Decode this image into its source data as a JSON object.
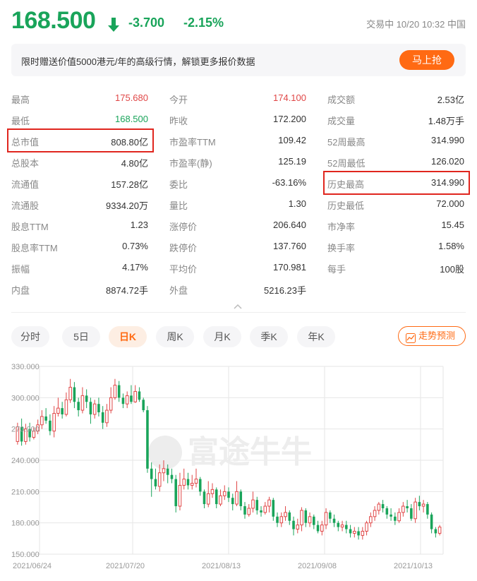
{
  "quote": {
    "price": "168.500",
    "change": "-3.700",
    "change_pct": "-2.15%",
    "status": "交易中 10/20 10:32 中国"
  },
  "banner": {
    "text": "限时赠送价值5000港元/年的高级行情，解锁更多报价数据",
    "button": "马上抢"
  },
  "stats": [
    [
      {
        "label": "最高",
        "value": "175.680",
        "color": "red"
      },
      {
        "label": "最低",
        "value": "168.500",
        "color": "green"
      },
      {
        "label": "总市值",
        "value": "808.80亿"
      },
      {
        "label": "总股本",
        "value": "4.80亿"
      },
      {
        "label": "流通值",
        "value": "157.28亿"
      },
      {
        "label": "流通股",
        "value": "9334.20万"
      },
      {
        "label": "股息TTM",
        "value": "1.23"
      },
      {
        "label": "股息率TTM",
        "value": "0.73%"
      },
      {
        "label": "振幅",
        "value": "4.17%"
      },
      {
        "label": "内盘",
        "value": "8874.72手"
      }
    ],
    [
      {
        "label": "今开",
        "value": "174.100",
        "color": "red"
      },
      {
        "label": "昨收",
        "value": "172.200"
      },
      {
        "label": "市盈率TTM",
        "value": "109.42"
      },
      {
        "label": "市盈率(静)",
        "value": "125.19"
      },
      {
        "label": "委比",
        "value": "-63.16%"
      },
      {
        "label": "量比",
        "value": "1.30"
      },
      {
        "label": "涨停价",
        "value": "206.640"
      },
      {
        "label": "跌停价",
        "value": "137.760"
      },
      {
        "label": "平均价",
        "value": "170.981"
      },
      {
        "label": "外盘",
        "value": "5216.23手"
      }
    ],
    [
      {
        "label": "成交额",
        "value": "2.53亿"
      },
      {
        "label": "成交量",
        "value": "1.48万手"
      },
      {
        "label": "52周最高",
        "value": "314.990"
      },
      {
        "label": "52周最低",
        "value": "126.020"
      },
      {
        "label": "历史最高",
        "value": "314.990"
      },
      {
        "label": "历史最低",
        "value": "72.000"
      },
      {
        "label": "市净率",
        "value": "15.45"
      },
      {
        "label": "换手率",
        "value": "1.58%"
      },
      {
        "label": "每手",
        "value": "100股"
      }
    ]
  ],
  "tabs": [
    "分时",
    "5日",
    "日K",
    "周K",
    "月K",
    "季K",
    "年K"
  ],
  "active_tab": "日K",
  "trend_button": "走势预测",
  "watermark": "富途牛牛",
  "colors": {
    "up": "#e04747",
    "down": "#19a45a",
    "accent": "#ff6a13",
    "highlight": "#e0261e"
  },
  "chart_data": {
    "type": "candlestick",
    "y_ticks": [
      "330.000",
      "300.000",
      "270.000",
      "240.000",
      "210.000",
      "180.000",
      "150.000"
    ],
    "x_labels": [
      "2021/06/24",
      "2021/07/20",
      "2021/08/13",
      "2021/09/08",
      "2021/10/13"
    ],
    "ylim": [
      150,
      330
    ],
    "candles": [
      [
        258,
        272,
        276,
        255
      ],
      [
        272,
        258,
        280,
        254
      ],
      [
        258,
        270,
        275,
        255
      ],
      [
        270,
        262,
        276,
        258
      ],
      [
        262,
        268,
        272,
        260
      ],
      [
        268,
        274,
        279,
        265
      ],
      [
        274,
        282,
        288,
        270
      ],
      [
        282,
        278,
        290,
        275
      ],
      [
        278,
        268,
        284,
        264
      ],
      [
        268,
        285,
        292,
        262
      ],
      [
        285,
        290,
        300,
        282
      ],
      [
        290,
        284,
        296,
        280
      ],
      [
        284,
        298,
        305,
        282
      ],
      [
        298,
        310,
        318,
        295
      ],
      [
        310,
        296,
        315,
        290
      ],
      [
        296,
        288,
        300,
        282
      ],
      [
        288,
        302,
        310,
        285
      ],
      [
        302,
        296,
        308,
        290
      ],
      [
        296,
        284,
        300,
        275
      ],
      [
        284,
        294,
        298,
        280
      ],
      [
        294,
        286,
        300,
        282
      ],
      [
        286,
        276,
        292,
        270
      ],
      [
        276,
        288,
        294,
        272
      ],
      [
        288,
        300,
        310,
        285
      ],
      [
        300,
        312,
        318,
        298
      ],
      [
        312,
        300,
        316,
        296
      ],
      [
        300,
        294,
        304,
        290
      ],
      [
        294,
        302,
        306,
        290
      ],
      [
        302,
        296,
        312,
        294
      ],
      [
        296,
        306,
        312,
        295
      ],
      [
        306,
        298,
        310,
        296
      ],
      [
        298,
        288,
        300,
        286
      ],
      [
        288,
        232,
        292,
        228
      ],
      [
        232,
        222,
        238,
        205
      ],
      [
        222,
        215,
        232,
        212
      ],
      [
        215,
        228,
        236,
        210
      ],
      [
        228,
        232,
        240,
        220
      ],
      [
        232,
        226,
        236,
        218
      ],
      [
        226,
        222,
        232,
        218
      ],
      [
        222,
        196,
        226,
        190
      ],
      [
        196,
        216,
        228,
        192
      ],
      [
        216,
        222,
        232,
        212
      ],
      [
        222,
        216,
        228,
        212
      ],
      [
        216,
        218,
        226,
        212
      ],
      [
        218,
        222,
        232,
        214
      ],
      [
        222,
        210,
        224,
        206
      ],
      [
        210,
        198,
        212,
        194
      ],
      [
        198,
        208,
        220,
        195
      ],
      [
        208,
        212,
        218,
        204
      ],
      [
        212,
        198,
        214,
        194
      ],
      [
        198,
        206,
        212,
        196
      ],
      [
        206,
        210,
        216,
        202
      ],
      [
        210,
        204,
        214,
        200
      ],
      [
        204,
        198,
        208,
        192
      ],
      [
        198,
        210,
        220,
        196
      ],
      [
        210,
        196,
        212,
        192
      ],
      [
        196,
        188,
        200,
        184
      ],
      [
        188,
        194,
        198,
        186
      ],
      [
        194,
        202,
        210,
        190
      ],
      [
        202,
        192,
        205,
        188
      ],
      [
        192,
        190,
        196,
        186
      ],
      [
        190,
        196,
        200,
        188
      ],
      [
        196,
        202,
        205,
        190
      ],
      [
        202,
        186,
        204,
        182
      ],
      [
        186,
        180,
        190,
        176
      ],
      [
        180,
        186,
        190,
        176
      ],
      [
        186,
        190,
        196,
        182
      ],
      [
        190,
        182,
        192,
        178
      ],
      [
        182,
        174,
        186,
        168
      ],
      [
        174,
        178,
        184,
        170
      ],
      [
        178,
        192,
        195,
        172
      ],
      [
        192,
        180,
        194,
        176
      ],
      [
        180,
        186,
        190,
        176
      ],
      [
        186,
        178,
        188,
        174
      ],
      [
        178,
        172,
        182,
        170
      ],
      [
        172,
        178,
        182,
        168
      ],
      [
        178,
        190,
        194,
        174
      ],
      [
        190,
        184,
        192,
        180
      ],
      [
        184,
        180,
        188,
        176
      ],
      [
        180,
        176,
        182,
        172
      ],
      [
        176,
        178,
        182,
        172
      ],
      [
        178,
        174,
        182,
        170
      ],
      [
        174,
        170,
        178,
        166
      ],
      [
        170,
        172,
        176,
        166
      ],
      [
        172,
        168,
        176,
        164
      ],
      [
        168,
        172,
        176,
        164
      ],
      [
        172,
        180,
        182,
        168
      ],
      [
        180,
        186,
        190,
        176
      ],
      [
        186,
        192,
        196,
        182
      ],
      [
        192,
        198,
        200,
        188
      ],
      [
        198,
        194,
        202,
        190
      ],
      [
        194,
        188,
        196,
        184
      ],
      [
        188,
        186,
        194,
        182
      ],
      [
        186,
        182,
        190,
        178
      ],
      [
        182,
        190,
        194,
        180
      ],
      [
        190,
        196,
        200,
        186
      ],
      [
        196,
        194,
        202,
        190
      ],
      [
        194,
        184,
        198,
        182
      ],
      [
        184,
        200,
        204,
        180
      ],
      [
        200,
        196,
        206,
        192
      ],
      [
        196,
        198,
        202,
        190
      ],
      [
        198,
        188,
        200,
        184
      ],
      [
        188,
        174,
        190,
        170
      ],
      [
        174,
        170,
        176,
        166
      ],
      [
        170,
        176,
        178,
        168
      ]
    ]
  }
}
